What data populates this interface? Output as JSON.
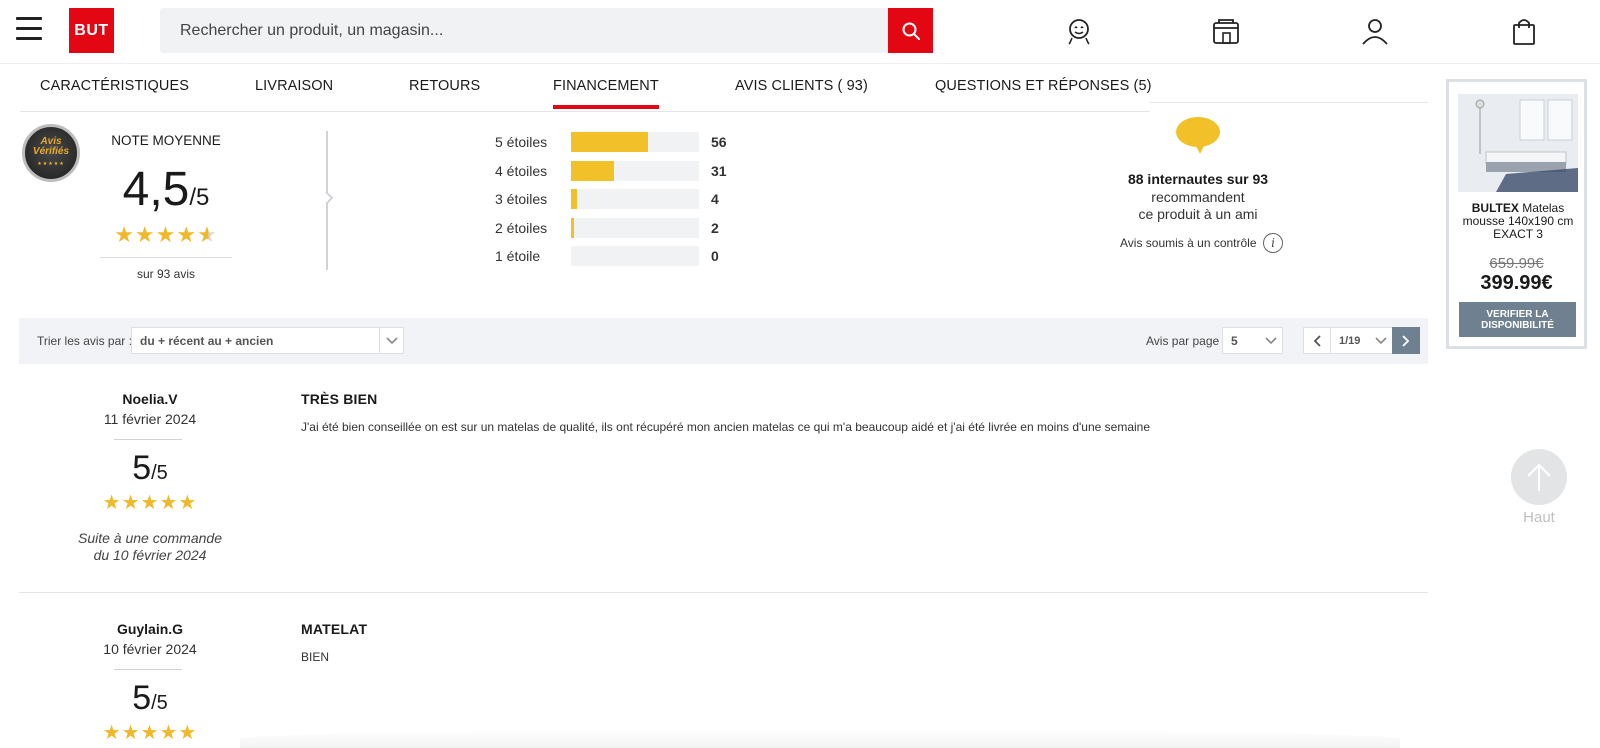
{
  "header": {
    "logo": "BUT",
    "search_placeholder": "Rechercher un produit, un magasin..."
  },
  "tabs": [
    {
      "label": "CARACTÉRISTIQUES"
    },
    {
      "label": "LIVRAISON"
    },
    {
      "label": "RETOURS"
    },
    {
      "label": "FINANCEMENT",
      "active": true
    },
    {
      "label": "AVIS CLIENTS ( 93)"
    },
    {
      "label": "QUESTIONS ET RÉPONSES (5)"
    }
  ],
  "badge": {
    "line1": "Avis",
    "line2": "Vérifiés"
  },
  "summary": {
    "title": "NOTE MOYENNE",
    "score": "4,5",
    "out_of": "/5",
    "rating": 4.5,
    "count_text": "sur 93 avis"
  },
  "distribution": [
    {
      "label": "5 étoiles",
      "count": 56
    },
    {
      "label": "4 étoiles",
      "count": 31
    },
    {
      "label": "3 étoiles",
      "count": 4
    },
    {
      "label": "2 étoiles",
      "count": 2
    },
    {
      "label": "1 étoile",
      "count": 0
    }
  ],
  "recommend": {
    "strong": "88 internautes sur 93",
    "line1": "recommandent",
    "line2": "ce produit à un ami",
    "control": "Avis soumis à un contrôle",
    "info": "i"
  },
  "filters": {
    "sort_label": "Trier les avis par :",
    "sort_value": "du + récent au + ancien",
    "per_page_label": "Avis par page :",
    "per_page_value": "5",
    "page_value": "1/19"
  },
  "reviews": [
    {
      "author": "Noelia.V",
      "date": "11 février 2024",
      "score": "5",
      "out_of": "/5",
      "order_line1": "Suite à une commande",
      "order_line2": "du 10 février 2024",
      "title": "TRÈS BIEN",
      "body": "J'ai été bien conseillée on est sur un matelas de qualité, ils ont récupéré mon ancien matelas ce qui m'a beaucoup aidé et j'ai été livrée en moins d'une semaine"
    },
    {
      "author": "Guylain.G",
      "date": "10 février 2024",
      "score": "5",
      "out_of": "/5",
      "title": "MATELAT",
      "body": "BIEN"
    }
  ],
  "product": {
    "brand": "BULTEX",
    "name": "Matelas mousse 140x190 cm EXACT 3",
    "old_price": "659.99€",
    "price": "399.99€",
    "button": "VERIFIER LA DISPONIBILITÉ"
  },
  "back_to_top": {
    "label": "Haut"
  },
  "colors": {
    "brand": "#e30613",
    "star": "#f0b92c",
    "bar": "#f2c129",
    "slate": "#6f8190"
  }
}
